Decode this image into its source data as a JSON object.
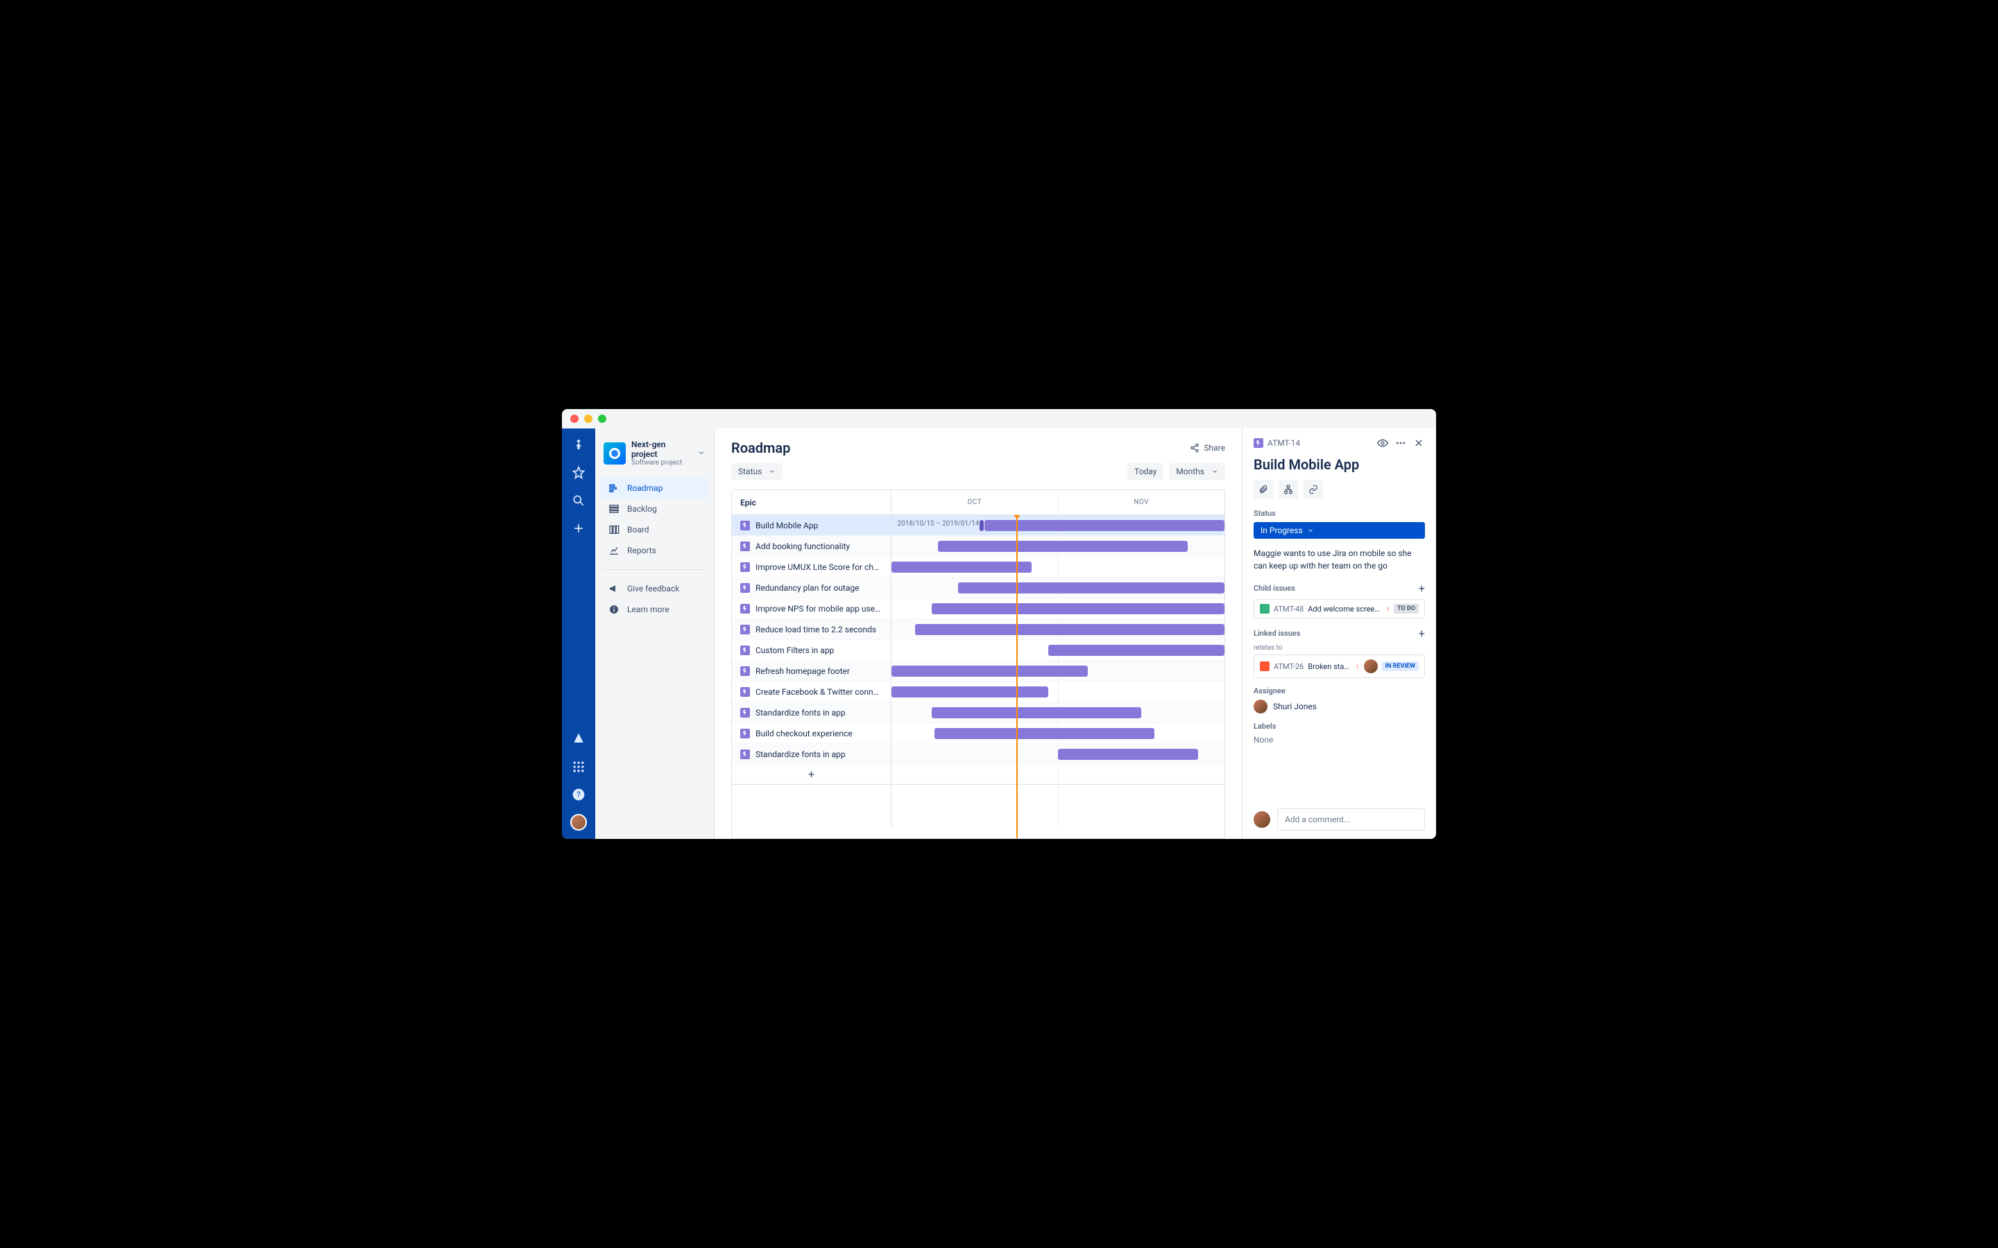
{
  "project": {
    "name": "Next-gen project",
    "type": "Software project"
  },
  "nav": {
    "roadmap": "Roadmap",
    "backlog": "Backlog",
    "board": "Board",
    "reports": "Reports",
    "feedback": "Give feedback",
    "learn": "Learn more"
  },
  "page": {
    "title": "Roadmap",
    "share": "Share",
    "status_filter": "Status",
    "today_btn": "Today",
    "scale_btn": "Months"
  },
  "gantt": {
    "epic_header": "Epic",
    "months": [
      "OCT",
      "NOV"
    ],
    "today_pct": 37.5,
    "date_range": "2018/10/15 – 2019/01/14",
    "epics": [
      {
        "title": "Build Mobile App",
        "start": 28,
        "width": 72,
        "selected": true,
        "has_handle": true
      },
      {
        "title": "Add booking functionality",
        "start": 14,
        "width": 75
      },
      {
        "title": "Improve UMUX Lite Score for checko...",
        "start": 0,
        "width": 42
      },
      {
        "title": "Redundancy plan for outage",
        "start": 20,
        "width": 80
      },
      {
        "title": "Improve NPS for mobile app users by ...",
        "start": 12,
        "width": 88
      },
      {
        "title": "Reduce load time to 2.2 seconds",
        "start": 7,
        "width": 93
      },
      {
        "title": "Custom Filters in app",
        "start": 47,
        "width": 53
      },
      {
        "title": "Refresh homepage footer",
        "start": 0,
        "width": 59
      },
      {
        "title": "Create Facebook & Twitter connector",
        "start": 0,
        "width": 47
      },
      {
        "title": "Standardize fonts in app",
        "start": 12,
        "width": 63
      },
      {
        "title": "Build checkout experience",
        "start": 13,
        "width": 66
      },
      {
        "title": "Standardize fonts in app",
        "start": 50,
        "width": 42
      }
    ]
  },
  "detail": {
    "key": "ATMT-14",
    "title": "Build Mobile App",
    "status_label": "Status",
    "status_value": "In Progress",
    "description": "Maggie wants to use Jira on mobile so she can keep up with her team on the go",
    "child_label": "Child issues",
    "child": {
      "key": "ATMT-48",
      "summary": "Add welcome screen for m...",
      "status": "TO DO"
    },
    "linked_label": "Linked issues",
    "relates": "relates to",
    "linked": {
      "key": "ATMT-26",
      "summary": "Broken status ind...",
      "status": "IN REVIEW"
    },
    "assignee_label": "Assignee",
    "assignee": "Shuri Jones",
    "labels_label": "Labels",
    "labels_value": "None",
    "comment_placeholder": "Add a comment..."
  }
}
